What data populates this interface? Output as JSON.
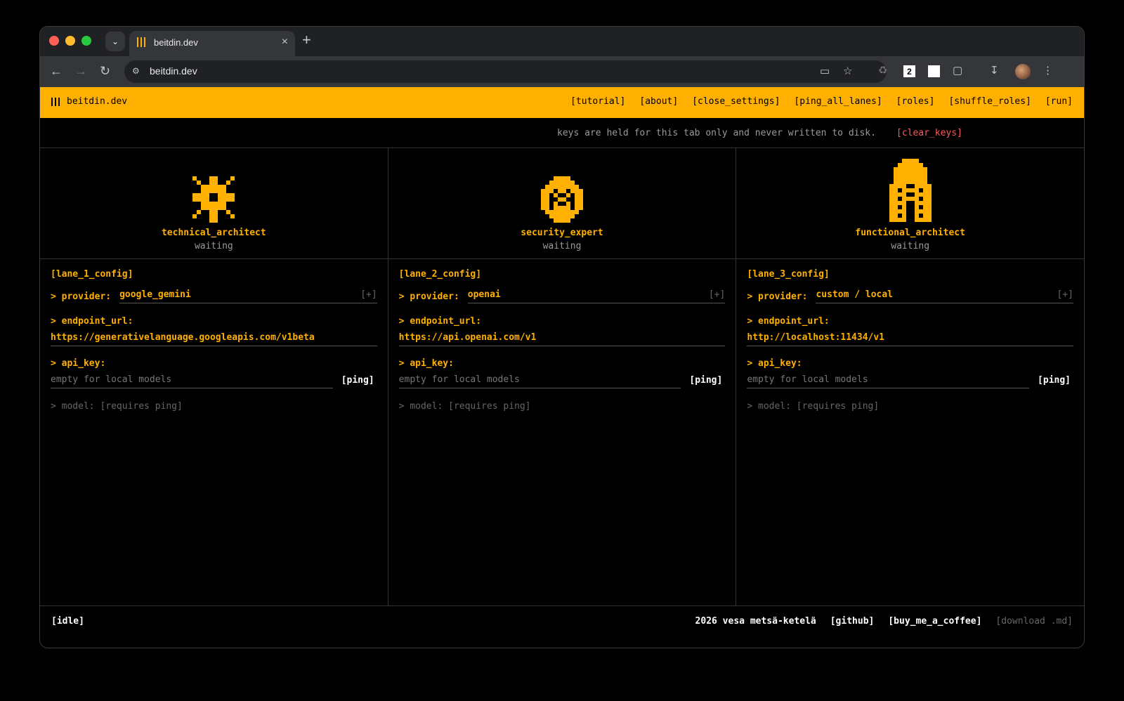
{
  "browser": {
    "tab_title": "beitdin.dev",
    "url": "beitdin.dev",
    "extension_badge": "2"
  },
  "app": {
    "brand": "beitdin.dev",
    "menu": [
      "[tutorial]",
      "[about]",
      "[close_settings]",
      "[ping_all_lanes]",
      "[roles]",
      "[shuffle_roles]",
      "[run]"
    ],
    "notice": "keys are held for this tab only and never written to disk.",
    "clear_keys": "[clear_keys]",
    "accent_color": "#ffb000",
    "lanes": [
      {
        "role": "technical_architect",
        "status": "waiting",
        "icon": "asterisk-glyph-icon",
        "config_title": "[lane_1_config]",
        "provider_label": "> provider:",
        "provider": "google_gemini",
        "add": "[+]",
        "endpoint_label": "> endpoint_url:",
        "endpoint": "https://generativelanguage.googleapis.com/v1beta",
        "api_key_label": "> api_key:",
        "api_key_placeholder": "empty for local models",
        "ping": "[ping]",
        "model": "> model: [requires ping]"
      },
      {
        "role": "security_expert",
        "status": "waiting",
        "icon": "shield-face-icon",
        "config_title": "[lane_2_config]",
        "provider_label": "> provider:",
        "provider": "openai",
        "add": "[+]",
        "endpoint_label": "> endpoint_url:",
        "endpoint": "https://api.openai.com/v1",
        "api_key_label": "> api_key:",
        "api_key_placeholder": "empty for local models",
        "ping": "[ping]",
        "model": "> model: [requires ping]"
      },
      {
        "role": "functional_architect",
        "status": "waiting",
        "icon": "building-icon",
        "config_title": "[lane_3_config]",
        "provider_label": "> provider:",
        "provider": "custom / local",
        "add": "[+]",
        "endpoint_label": "> endpoint_url:",
        "endpoint": "http://localhost:11434/v1",
        "api_key_label": "> api_key:",
        "api_key_placeholder": "empty for local models",
        "ping": "[ping]",
        "model": "> model: [requires ping]"
      }
    ],
    "footer": {
      "status": "[idle]",
      "credit": "2026 vesa metsä-ketelä",
      "github": "[github]",
      "coffee": "[buy_me_a_coffee]",
      "download": "[download .md]"
    }
  }
}
